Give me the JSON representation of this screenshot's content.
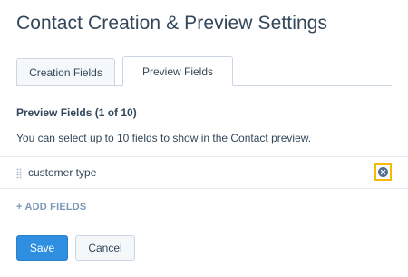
{
  "page": {
    "title": "Contact Creation & Preview Settings"
  },
  "tabs": [
    {
      "label": "Creation Fields",
      "active": false
    },
    {
      "label": "Preview Fields",
      "active": true
    }
  ],
  "section": {
    "title": "Preview Fields (1 of 10)",
    "description": "You can select up to 10 fields to show in the Contact preview."
  },
  "fields": [
    {
      "label": "customer type",
      "icon": "remove-circle-icon"
    }
  ],
  "add_fields": {
    "label": "+ ADD FIELDS"
  },
  "buttons": {
    "save_label": "Save",
    "cancel_label": "Cancel"
  },
  "colors": {
    "primary": "#2e8ee0",
    "highlight": "#f5b90a",
    "text": "#33475b",
    "muted": "#7c98b6"
  }
}
